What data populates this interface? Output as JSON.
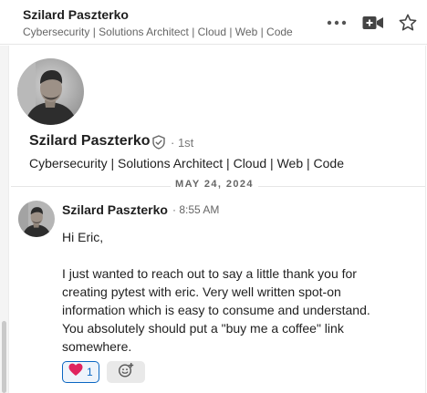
{
  "header": {
    "name": "Szilard Paszterko",
    "tagline": "Cybersecurity | Solutions Architect | Cloud | Web | Code"
  },
  "profile": {
    "name": "Szilard Paszterko",
    "degree": "· 1st",
    "headline": "Cybersecurity | Solutions Architect | Cloud | Web | Code"
  },
  "conversation": {
    "date": "MAY 24, 2024",
    "message": {
      "sender": "Szilard Paszterko",
      "time": "· 8:55 AM",
      "greeting": "Hi Eric,",
      "body": "I just wanted to reach out to say a little thank you for creating pytest with eric. Very well written spot-on information which is easy to consume and understand. You absolutely should put a \"buy me a coffee\" link somewhere.",
      "reactions": [
        {
          "icon": "heart-icon",
          "count": "1"
        }
      ]
    }
  },
  "colors": {
    "accent": "#0a66c2",
    "heart": "#e0245e"
  }
}
